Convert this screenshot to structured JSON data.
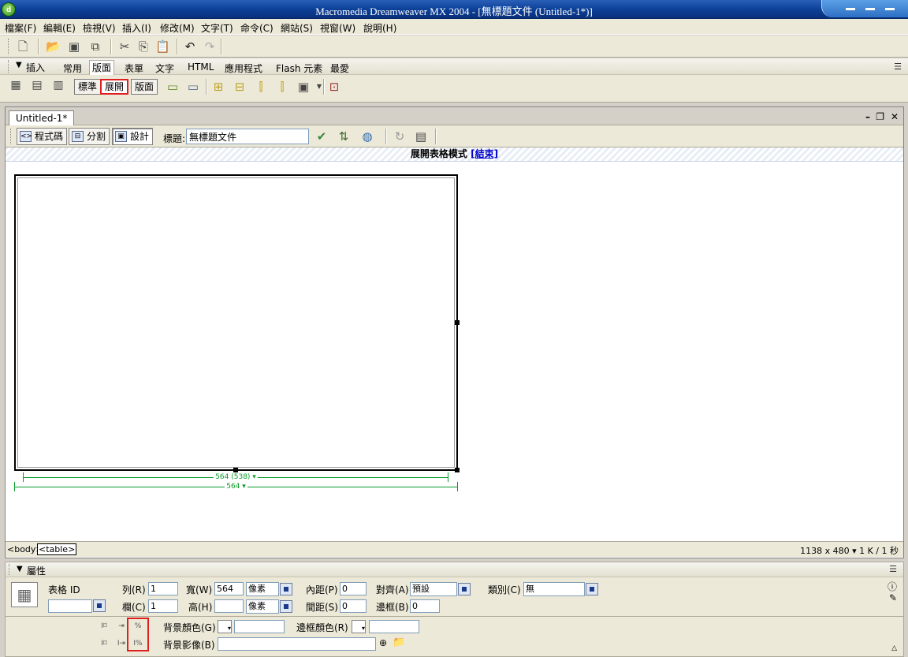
{
  "window": {
    "title": "Macromedia Dreamweaver MX 2004 - [無標題文件 (Untitled-1*)]"
  },
  "menubar": {
    "items": [
      "檔案(F)",
      "編輯(E)",
      "檢視(V)",
      "插入(I)",
      "修改(M)",
      "文字(T)",
      "命令(C)",
      "網站(S)",
      "視窗(W)",
      "說明(H)"
    ]
  },
  "insert_bar": {
    "label": "插入",
    "tabs": [
      "常用",
      "版面",
      "表單",
      "文字",
      "HTML",
      "應用程式",
      "Flash 元素",
      "最愛"
    ],
    "selected_tab": "版面",
    "layout_modes": [
      "標準",
      "展開",
      "版面"
    ],
    "pressed_mode": "展開"
  },
  "document": {
    "tab_label": "Untitled-1*",
    "view_buttons": [
      "程式碼",
      "分割",
      "設計"
    ],
    "active_view": "設計",
    "title_label": "標題:",
    "title_value": "無標題文件",
    "mode_banner": "展開表格模式",
    "mode_banner_exit": "[結束]",
    "table_width_inner": "564 (538) ▾",
    "table_width_outer": "564 ▾",
    "tag_body": "<body>",
    "tag_table": "<table>",
    "status_size": "1138 x 480 ▾  1 K / 1 秒"
  },
  "properties": {
    "label": "屬性",
    "table_id_label": "表格 ID",
    "rows_label": "列(R)",
    "rows_value": "1",
    "cols_label": "欄(C)",
    "cols_value": "1",
    "width_label": "寬(W)",
    "width_value": "564",
    "width_unit": "像素",
    "height_label": "高(H)",
    "height_value": "",
    "height_unit": "像素",
    "padding_label": "內距(P)",
    "padding_value": "0",
    "spacing_label": "間距(S)",
    "spacing_value": "0",
    "align_label": "對齊(A)",
    "align_value": "預設",
    "border_label": "邊框(B)",
    "border_value": "0",
    "class_label": "類別(C)",
    "class_value": "無",
    "bg_color_label": "背景顏色(G)",
    "border_color_label": "邊框顏色(R)",
    "bg_image_label": "背景影像(B)"
  },
  "colors": {
    "highlight_red": "#e02020",
    "width_guide_green": "#0a9a2a",
    "titlebar_blue": "#0b3f96"
  }
}
